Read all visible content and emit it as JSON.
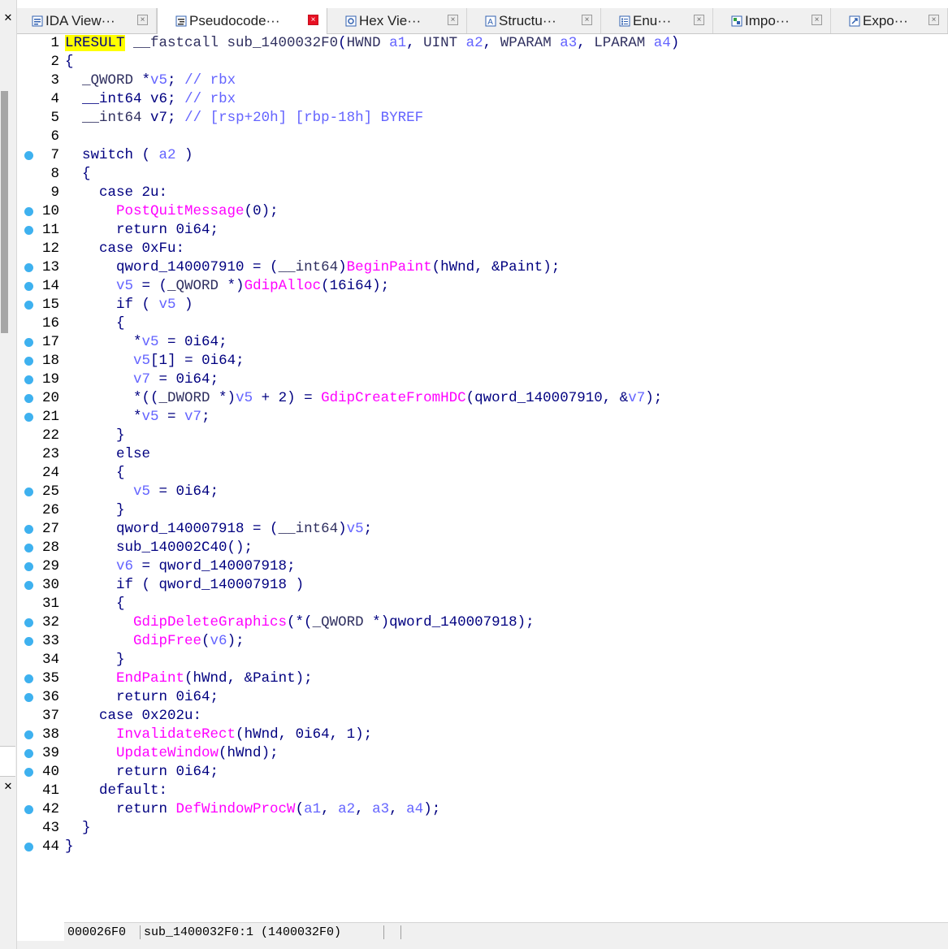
{
  "left_dock": {
    "close_glyph": "✕"
  },
  "tabs": [
    {
      "label": "IDA View···",
      "icon": "ida-view-icon",
      "active": false
    },
    {
      "label": "Pseudocode···",
      "icon": "pseudocode-icon",
      "active": true
    },
    {
      "label": "Hex Vie···",
      "icon": "hex-view-icon",
      "active": false
    },
    {
      "label": "Structu···",
      "icon": "structures-icon",
      "active": false
    },
    {
      "label": "Enu···",
      "icon": "enums-icon",
      "active": false
    },
    {
      "label": "Impo···",
      "icon": "imports-icon",
      "active": false
    },
    {
      "label": "Expo···",
      "icon": "exports-icon",
      "active": false
    }
  ],
  "tab_close_glyph": "×",
  "code": {
    "lines": [
      {
        "n": "1",
        "dot": false,
        "tokens": [
          [
            "hl",
            "LRESULT"
          ],
          [
            "ty",
            " __fastcall "
          ],
          [
            "ty",
            "sub_1400032F0"
          ],
          [
            "pn",
            "("
          ],
          [
            "ty",
            "HWND "
          ],
          [
            "vr",
            "a1"
          ],
          [
            "pn",
            ", "
          ],
          [
            "ty",
            "UINT "
          ],
          [
            "vr",
            "a2"
          ],
          [
            "pn",
            ", "
          ],
          [
            "ty",
            "WPARAM "
          ],
          [
            "vr",
            "a3"
          ],
          [
            "pn",
            ", "
          ],
          [
            "ty",
            "LPARAM "
          ],
          [
            "vr",
            "a4"
          ],
          [
            "pn",
            ")"
          ]
        ]
      },
      {
        "n": "2",
        "dot": false,
        "tokens": [
          [
            "pn",
            "{"
          ]
        ]
      },
      {
        "n": "3",
        "dot": false,
        "tokens": [
          [
            "ty",
            "  _QWORD "
          ],
          [
            "pn",
            "*"
          ],
          [
            "vr",
            "v5"
          ],
          [
            "pn",
            "; "
          ],
          [
            "cm",
            "// rbx"
          ]
        ]
      },
      {
        "n": "4",
        "dot": false,
        "tokens": [
          [
            "kw",
            "  __int64 "
          ],
          [
            "kw",
            "v6"
          ],
          [
            "pn",
            "; "
          ],
          [
            "cm",
            "// rbx"
          ]
        ]
      },
      {
        "n": "5",
        "dot": false,
        "tokens": [
          [
            "ty",
            "  __int64 "
          ],
          [
            "kw",
            "v7"
          ],
          [
            "pn",
            "; "
          ],
          [
            "cm",
            "// [rsp+20h] [rbp-18h] BYREF"
          ]
        ]
      },
      {
        "n": "6",
        "dot": false,
        "tokens": []
      },
      {
        "n": "7",
        "dot": true,
        "tokens": [
          [
            "kw",
            "  switch "
          ],
          [
            "pn",
            "( "
          ],
          [
            "vr",
            "a2"
          ],
          [
            "pn",
            " )"
          ]
        ]
      },
      {
        "n": "8",
        "dot": false,
        "tokens": [
          [
            "pn",
            "  {"
          ]
        ]
      },
      {
        "n": "9",
        "dot": false,
        "tokens": [
          [
            "kw",
            "    case "
          ],
          [
            "nm",
            "2u"
          ],
          [
            "pn",
            ":"
          ]
        ]
      },
      {
        "n": "10",
        "dot": true,
        "tokens": [
          [
            "fn",
            "      PostQuitMessage"
          ],
          [
            "pn",
            "("
          ],
          [
            "nm",
            "0"
          ],
          [
            "pn",
            ");"
          ]
        ]
      },
      {
        "n": "11",
        "dot": true,
        "tokens": [
          [
            "kw",
            "      return "
          ],
          [
            "nm",
            "0i64"
          ],
          [
            "pn",
            ";"
          ]
        ]
      },
      {
        "n": "12",
        "dot": false,
        "tokens": [
          [
            "kw",
            "    case "
          ],
          [
            "nm",
            "0xFu"
          ],
          [
            "pn",
            ":"
          ]
        ]
      },
      {
        "n": "13",
        "dot": true,
        "tokens": [
          [
            "gl",
            "      qword_140007910"
          ],
          [
            "pn",
            " = ("
          ],
          [
            "ty",
            "__int64"
          ],
          [
            "pn",
            ")"
          ],
          [
            "fn",
            "BeginPaint"
          ],
          [
            "pn",
            "("
          ],
          [
            "gl",
            "hWnd"
          ],
          [
            "pn",
            ", &"
          ],
          [
            "gl",
            "Paint"
          ],
          [
            "pn",
            ");"
          ]
        ]
      },
      {
        "n": "14",
        "dot": true,
        "tokens": [
          [
            "vr",
            "      v5"
          ],
          [
            "pn",
            " = ("
          ],
          [
            "ty",
            "_QWORD "
          ],
          [
            "pn",
            "*)"
          ],
          [
            "fn",
            "GdipAlloc"
          ],
          [
            "pn",
            "("
          ],
          [
            "nm",
            "16i64"
          ],
          [
            "pn",
            ");"
          ]
        ]
      },
      {
        "n": "15",
        "dot": true,
        "tokens": [
          [
            "kw",
            "      if "
          ],
          [
            "pn",
            "( "
          ],
          [
            "vr",
            "v5"
          ],
          [
            "pn",
            " )"
          ]
        ]
      },
      {
        "n": "16",
        "dot": false,
        "tokens": [
          [
            "pn",
            "      {"
          ]
        ]
      },
      {
        "n": "17",
        "dot": true,
        "tokens": [
          [
            "pn",
            "        *"
          ],
          [
            "vr",
            "v5"
          ],
          [
            "pn",
            " = "
          ],
          [
            "nm",
            "0i64"
          ],
          [
            "pn",
            ";"
          ]
        ]
      },
      {
        "n": "18",
        "dot": true,
        "tokens": [
          [
            "vr",
            "        v5"
          ],
          [
            "pn",
            "["
          ],
          [
            "nm",
            "1"
          ],
          [
            "pn",
            "] = "
          ],
          [
            "nm",
            "0i64"
          ],
          [
            "pn",
            ";"
          ]
        ]
      },
      {
        "n": "19",
        "dot": true,
        "tokens": [
          [
            "vr",
            "        v7"
          ],
          [
            "pn",
            " = "
          ],
          [
            "nm",
            "0i64"
          ],
          [
            "pn",
            ";"
          ]
        ]
      },
      {
        "n": "20",
        "dot": true,
        "tokens": [
          [
            "pn",
            "        *(("
          ],
          [
            "ty",
            "_DWORD "
          ],
          [
            "pn",
            "*)"
          ],
          [
            "vr",
            "v5"
          ],
          [
            "pn",
            " + "
          ],
          [
            "nm",
            "2"
          ],
          [
            "pn",
            ") = "
          ],
          [
            "fn",
            "GdipCreateFromHDC"
          ],
          [
            "pn",
            "("
          ],
          [
            "gl",
            "qword_140007910"
          ],
          [
            "pn",
            ", &"
          ],
          [
            "vr",
            "v7"
          ],
          [
            "pn",
            ");"
          ]
        ]
      },
      {
        "n": "21",
        "dot": true,
        "tokens": [
          [
            "pn",
            "        *"
          ],
          [
            "vr",
            "v5"
          ],
          [
            "pn",
            " = "
          ],
          [
            "vr",
            "v7"
          ],
          [
            "pn",
            ";"
          ]
        ]
      },
      {
        "n": "22",
        "dot": false,
        "tokens": [
          [
            "pn",
            "      }"
          ]
        ]
      },
      {
        "n": "23",
        "dot": false,
        "tokens": [
          [
            "kw",
            "      else"
          ]
        ]
      },
      {
        "n": "24",
        "dot": false,
        "tokens": [
          [
            "pn",
            "      {"
          ]
        ]
      },
      {
        "n": "25",
        "dot": true,
        "tokens": [
          [
            "vr",
            "        v5"
          ],
          [
            "pn",
            " = "
          ],
          [
            "nm",
            "0i64"
          ],
          [
            "pn",
            ";"
          ]
        ]
      },
      {
        "n": "26",
        "dot": false,
        "tokens": [
          [
            "pn",
            "      }"
          ]
        ]
      },
      {
        "n": "27",
        "dot": true,
        "tokens": [
          [
            "gl",
            "      qword_140007918"
          ],
          [
            "pn",
            " = ("
          ],
          [
            "ty",
            "__int64"
          ],
          [
            "pn",
            ")"
          ],
          [
            "vr",
            "v5"
          ],
          [
            "pn",
            ";"
          ]
        ]
      },
      {
        "n": "28",
        "dot": true,
        "tokens": [
          [
            "gl",
            "      sub_140002C40"
          ],
          [
            "pn",
            "();"
          ]
        ]
      },
      {
        "n": "29",
        "dot": true,
        "tokens": [
          [
            "vr",
            "      v6"
          ],
          [
            "pn",
            " = "
          ],
          [
            "gl",
            "qword_140007918"
          ],
          [
            "pn",
            ";"
          ]
        ]
      },
      {
        "n": "30",
        "dot": true,
        "tokens": [
          [
            "kw",
            "      if "
          ],
          [
            "pn",
            "( "
          ],
          [
            "gl",
            "qword_140007918"
          ],
          [
            "pn",
            " )"
          ]
        ]
      },
      {
        "n": "31",
        "dot": false,
        "tokens": [
          [
            "pn",
            "      {"
          ]
        ]
      },
      {
        "n": "32",
        "dot": true,
        "tokens": [
          [
            "fn",
            "        GdipDeleteGraphics"
          ],
          [
            "pn",
            "(*("
          ],
          [
            "ty",
            "_QWORD "
          ],
          [
            "pn",
            "*)"
          ],
          [
            "gl",
            "qword_140007918"
          ],
          [
            "pn",
            ");"
          ]
        ]
      },
      {
        "n": "33",
        "dot": true,
        "tokens": [
          [
            "fn",
            "        GdipFree"
          ],
          [
            "pn",
            "("
          ],
          [
            "vr",
            "v6"
          ],
          [
            "pn",
            ");"
          ]
        ]
      },
      {
        "n": "34",
        "dot": false,
        "tokens": [
          [
            "pn",
            "      }"
          ]
        ]
      },
      {
        "n": "35",
        "dot": true,
        "tokens": [
          [
            "fn",
            "      EndPaint"
          ],
          [
            "pn",
            "("
          ],
          [
            "gl",
            "hWnd"
          ],
          [
            "pn",
            ", &"
          ],
          [
            "gl",
            "Paint"
          ],
          [
            "pn",
            ");"
          ]
        ]
      },
      {
        "n": "36",
        "dot": true,
        "tokens": [
          [
            "kw",
            "      return "
          ],
          [
            "nm",
            "0i64"
          ],
          [
            "pn",
            ";"
          ]
        ]
      },
      {
        "n": "37",
        "dot": false,
        "tokens": [
          [
            "kw",
            "    case "
          ],
          [
            "nm",
            "0x202u"
          ],
          [
            "pn",
            ":"
          ]
        ]
      },
      {
        "n": "38",
        "dot": true,
        "tokens": [
          [
            "fn",
            "      InvalidateRect"
          ],
          [
            "pn",
            "("
          ],
          [
            "gl",
            "hWnd"
          ],
          [
            "pn",
            ", "
          ],
          [
            "nm",
            "0i64"
          ],
          [
            "pn",
            ", "
          ],
          [
            "nm",
            "1"
          ],
          [
            "pn",
            ");"
          ]
        ]
      },
      {
        "n": "39",
        "dot": true,
        "tokens": [
          [
            "fn",
            "      UpdateWindow"
          ],
          [
            "pn",
            "("
          ],
          [
            "gl",
            "hWnd"
          ],
          [
            "pn",
            ");"
          ]
        ]
      },
      {
        "n": "40",
        "dot": true,
        "tokens": [
          [
            "kw",
            "      return "
          ],
          [
            "nm",
            "0i64"
          ],
          [
            "pn",
            ";"
          ]
        ]
      },
      {
        "n": "41",
        "dot": false,
        "tokens": [
          [
            "kw",
            "    default"
          ],
          [
            "pn",
            ":"
          ]
        ]
      },
      {
        "n": "42",
        "dot": true,
        "tokens": [
          [
            "kw",
            "      return "
          ],
          [
            "fn",
            "DefWindowProcW"
          ],
          [
            "pn",
            "("
          ],
          [
            "vr",
            "a1"
          ],
          [
            "pn",
            ", "
          ],
          [
            "vr",
            "a2"
          ],
          [
            "pn",
            ", "
          ],
          [
            "vr",
            "a3"
          ],
          [
            "pn",
            ", "
          ],
          [
            "vr",
            "a4"
          ],
          [
            "pn",
            ");"
          ]
        ]
      },
      {
        "n": "43",
        "dot": false,
        "tokens": [
          [
            "pn",
            "  }"
          ]
        ]
      },
      {
        "n": "44",
        "dot": true,
        "tokens": [
          [
            "pn",
            "}"
          ]
        ]
      }
    ]
  },
  "status": {
    "offset": "000026F0",
    "location": "sub_1400032F0:1 (1400032F0)"
  },
  "colors": {
    "breakpoint_dot": "#3eb1ef",
    "keyword": "#000080",
    "function": "#ff00ff",
    "variable": "#6464ff",
    "highlight": "#ffff00",
    "active_tab_close": "#e81123"
  }
}
